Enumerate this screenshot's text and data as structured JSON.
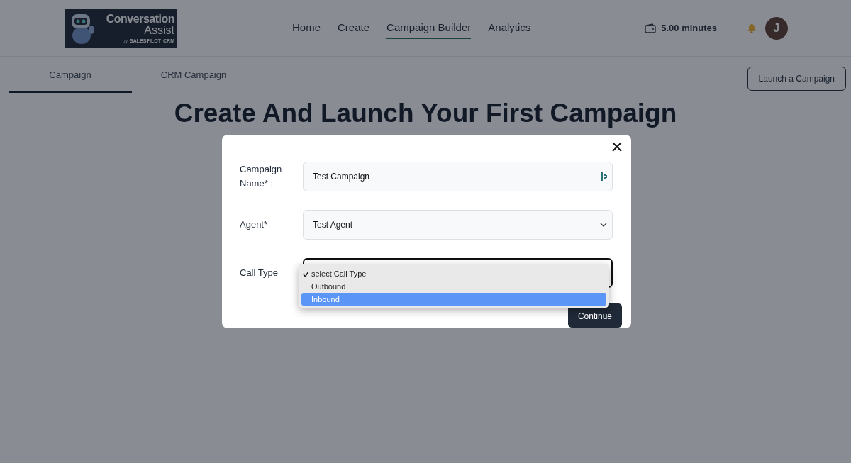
{
  "header": {
    "logo": {
      "title": "Conversation",
      "subtitle": "Assist",
      "byline": "by",
      "brand": "SALESPILOT",
      "brand_suffix": "CRM"
    },
    "nav": [
      {
        "label": "Home",
        "selected": false
      },
      {
        "label": "Create",
        "selected": false
      },
      {
        "label": "Campaign Builder",
        "selected": true
      },
      {
        "label": "Analytics",
        "selected": false
      }
    ],
    "balance": "5.00 minutes",
    "avatar": "J"
  },
  "tabs": [
    {
      "label": "Campaign",
      "selected": true
    },
    {
      "label": "CRM Campaign",
      "selected": false
    }
  ],
  "launch_button": "Launch a Campaign",
  "heading": "Create And Launch Your First Campaign",
  "modal": {
    "fields": [
      {
        "kind": "text",
        "label": "Campaign Name* :",
        "value": "Test Campaign",
        "focused": false
      },
      {
        "kind": "select",
        "label": "Agent*",
        "value": "Test Agent",
        "focused": false
      },
      {
        "kind": "dropdown",
        "label": "Call Type",
        "focused": true,
        "options": [
          {
            "label": "select Call Type",
            "selected": true,
            "highlighted": false
          },
          {
            "label": "Outbound",
            "selected": false,
            "highlighted": false
          },
          {
            "label": "Inbound",
            "selected": false,
            "highlighted": true
          }
        ]
      }
    ],
    "continue_button": "Continue"
  }
}
